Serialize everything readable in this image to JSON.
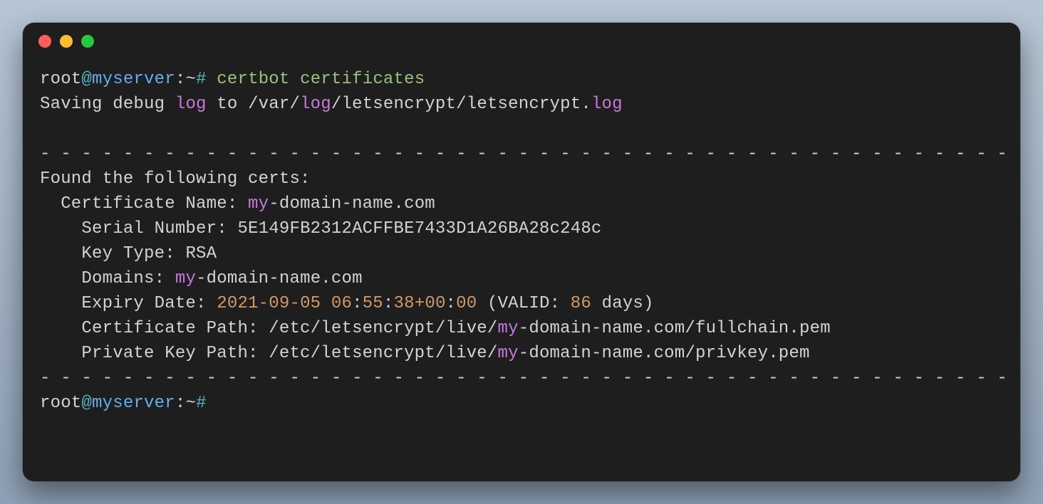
{
  "traffic_lights": {
    "red": "close",
    "yellow": "minimize",
    "green": "zoom"
  },
  "prompt": {
    "user": "root",
    "at": "@",
    "host": "myserver",
    "pathsep": ":",
    "tilde": "~",
    "sym": "#"
  },
  "command": "certbot certificates",
  "output": {
    "saving_prefix": "Saving debug ",
    "saving_log1": "log",
    "saving_mid": " to /var/",
    "saving_log2": "log",
    "saving_tail": "/letsencrypt/letsencrypt.",
    "saving_log3": "log",
    "blank": " ",
    "divider": "- - - - - - - - - - - - - - - - - - - - - - - - - - - - - - - - - - - - - - - - - - - - - - - - - -",
    "found": "Found the following certs:",
    "cert_name_label": "  Certificate Name: ",
    "cert_name_kw": "my",
    "cert_name_rest": "-domain-name.com",
    "serial_label": "    Serial Number: ",
    "serial_value": "5E149FB2312ACFFBE7433D1A26BA28c248c",
    "keytype_label": "    Key Type: ",
    "keytype_value": "RSA",
    "domains_label": "    Domains: ",
    "domains_kw": "my",
    "domains_rest": "-domain-name.com",
    "expiry_label": "    Expiry Date: ",
    "expiry_date": "2021-09-05 06",
    "expiry_colon1": ":",
    "expiry_min": "55",
    "expiry_colon2": ":",
    "expiry_sec": "38+00",
    "expiry_colon3": ":",
    "expiry_tz": "00",
    "expiry_validp": " (VALID: ",
    "expiry_days": "86",
    "expiry_tail": " days)",
    "certpath_label": "    Certificate Path: /etc/letsencrypt/live/",
    "certpath_kw": "my",
    "certpath_rest": "-domain-name.com/fullchain.pem",
    "keypath_label": "    Private Key Path: /etc/letsencrypt/live/",
    "keypath_kw": "my",
    "keypath_rest": "-domain-name.com/privkey.pem"
  },
  "prompt2": {
    "user": "root",
    "at": "@",
    "host": "myserver",
    "pathsep": ":",
    "tilde": "~",
    "sym": "#"
  }
}
